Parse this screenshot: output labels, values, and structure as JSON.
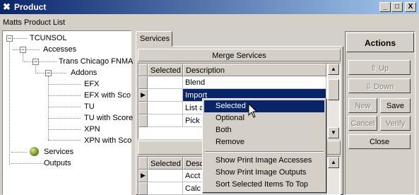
{
  "window": {
    "title": "Product",
    "minimize": "_",
    "maximize": "□",
    "close": "X"
  },
  "breadcrumb": "Matts Product List",
  "tree": {
    "root": "TCUNSOL",
    "accesses": "Accesses",
    "access_item": "Trans Chicago FNMA",
    "addons": "Addons",
    "addon_items": [
      "EFX",
      "EFX with Sco",
      "TU",
      "TU with Score",
      "XPN",
      "XPN with Sco"
    ],
    "services": "Services",
    "outputs": "Outputs"
  },
  "tab": {
    "label": "Services"
  },
  "merge": {
    "title": "Merge Services",
    "columns": [
      "Selected",
      "Description"
    ],
    "rows": [
      "Blend",
      "Import",
      "List a",
      "Pick"
    ],
    "selected_row": 1
  },
  "lower_grid": {
    "columns": [
      "Selected",
      "Descr"
    ],
    "rows": [
      "Acct",
      "Calc"
    ]
  },
  "context_menu": {
    "group1": [
      "Selected",
      "Optional",
      "Both",
      "Remove"
    ],
    "group2": [
      "Show Print Image Accesses",
      "Show Print Image Outputs",
      "Sort Selected Items To Top"
    ],
    "highlighted": "Selected"
  },
  "actions": {
    "title": "Actions",
    "up": "Up",
    "down": "Down",
    "new": "New",
    "save": "Save",
    "cancel": "Cancel",
    "verify": "Verify",
    "close": "Close"
  },
  "colors": {
    "title_bar": "#0a246a",
    "selection": "#0a246a",
    "face": "#d4d0c8",
    "ball": "#6b8e23"
  },
  "icons": [
    "app-icon",
    "expand-icon",
    "collapse-icon",
    "services-ball-icon",
    "row-pointer-icon",
    "up-arrow-icon",
    "down-arrow-icon",
    "mouse-cursor-icon"
  ]
}
